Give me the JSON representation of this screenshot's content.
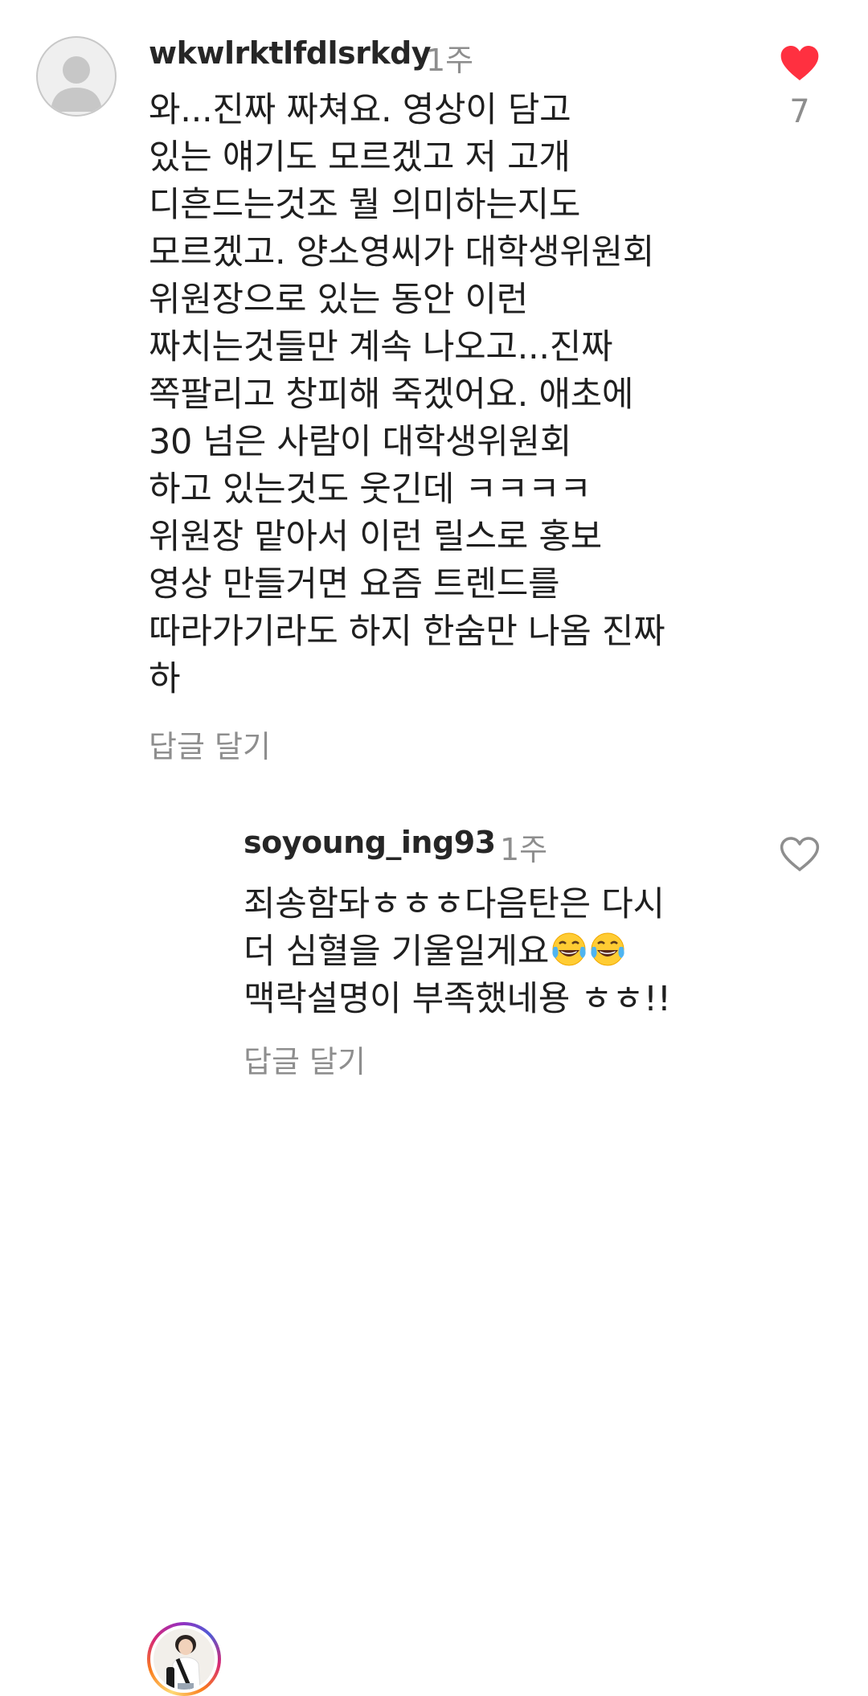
{
  "comments": [
    {
      "username": "wkwlrktlfdlsrkdy",
      "time": "1주",
      "lines": [
        "와...진짜 짜쳐요. 영상이 담고",
        "있는 얘기도 모르겠고 저 고개",
        "디흔드는것조 뭘 의미하는지도",
        "모르겠고. 양소영씨가 대학생위원회",
        "위원장으로 있는 동안 이런",
        "짜치는것들만 계속 나오고...진짜",
        "쪽팔리고 창피해 죽겠어요. 애초에",
        "30 넘은 사람이 대학생위원회",
        "하고 있는것도 웃긴데 ㅋㅋㅋㅋ",
        "위원장 맡아서 이런 릴스로 홍보",
        "영상 만들거면 요즘 트렌드를",
        "따라가기라도 하지 한숨만 나옴 진짜",
        "하"
      ],
      "reply_label": "답글 달기",
      "like_count": "7",
      "liked": true,
      "like_color": "#ff3040"
    }
  ],
  "reply": {
    "username": "soyoung_ing93",
    "time": "1주",
    "line1": "죄송함돠ㅎㅎㅎ다음탄은 다시",
    "line2": "더 심혈을 기울일게요",
    "line3": "맥락설명이 부족했네용 ㅎㅎ!!",
    "emojis": [
      "face-with-tears-of-joy",
      "face-with-tears-of-joy"
    ],
    "reply_label": "답글 달기",
    "liked": false
  }
}
